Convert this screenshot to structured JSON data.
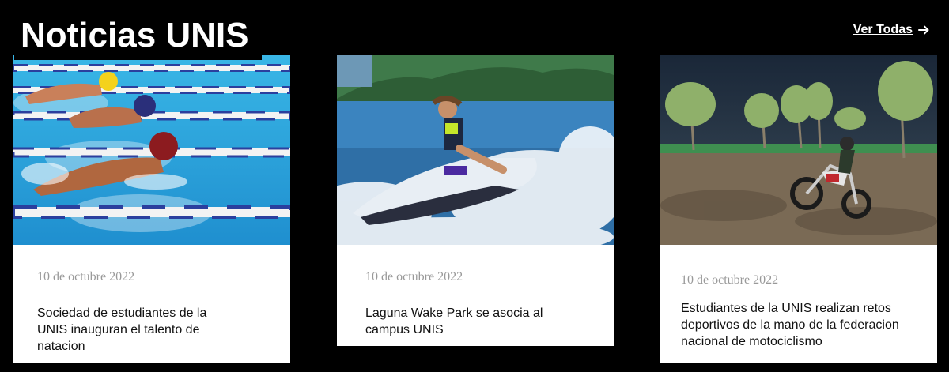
{
  "header": {
    "title": "Noticias UNIS",
    "view_all_label": "Ver Todas",
    "view_all_icon": "arrow-right-icon"
  },
  "cards": [
    {
      "image_subject": "swimmers-butterfly-image",
      "date": "10 de octubre 2022",
      "title": "Sociedad de estudiantes de la UNIS inauguran el talento de natacion"
    },
    {
      "image_subject": "jet-ski-image",
      "date": "10 de octubre 2022",
      "title": "Laguna Wake Park se asocia al campus UNIS"
    },
    {
      "image_subject": "motocross-night-image",
      "date": "10 de octubre 2022",
      "title": "Estudiantes de la UNIS realizan retos deportivos de la mano de la federacion nacional de motociclismo"
    }
  ],
  "colors": {
    "background": "#000000",
    "card": "#ffffff",
    "date_text": "#999999",
    "title_text": "#111111"
  }
}
